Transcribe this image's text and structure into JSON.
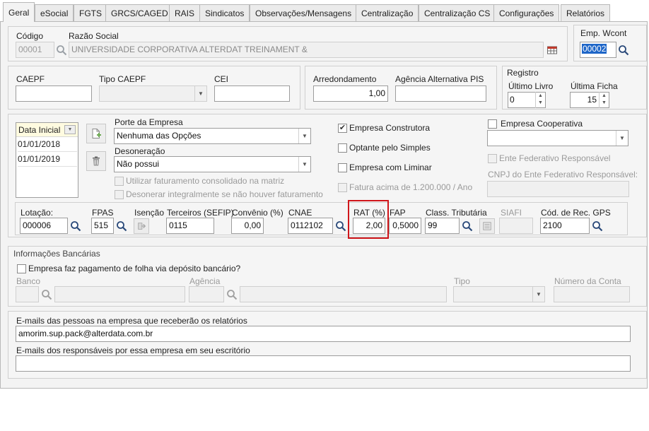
{
  "tabs": [
    "Geral",
    "eSocial",
    "FGTS",
    "GRCS/CAGED",
    "RAIS",
    "Sindicatos",
    "Observações/Mensagens",
    "Centralização",
    "Centralização CS",
    "Configurações",
    "Relatórios"
  ],
  "empresa": {
    "codigo_label": "Código",
    "codigo_value": "00001",
    "razao_label": "Razão Social",
    "razao_value": "UNIVERSIDADE CORPORATIVA ALTERDAT TREINAMENT &",
    "wcont_label": "Emp. Wcont",
    "wcont_value": "00002"
  },
  "caepf": {
    "caepf_label": "CAEPF",
    "tipo_label": "Tipo CAEPF",
    "cei_label": "CEI"
  },
  "arred": {
    "arred_label": "Arredondamento",
    "arred_value": "1,00",
    "agencia_label": "Agência Alternativa PIS"
  },
  "registro": {
    "title": "Registro",
    "livro_label": "Último Livro",
    "livro_value": "0",
    "ficha_label": "Última Ficha",
    "ficha_value": "15"
  },
  "datas": {
    "header": "Data Inicial",
    "rows": [
      "01/01/2018",
      "01/01/2019"
    ]
  },
  "porte": {
    "label": "Porte da Empresa",
    "value": "Nenhuma das Opções"
  },
  "deson": {
    "label": "Desoneração",
    "value": "Não possui"
  },
  "opcoes": {
    "fat_consolidado": "Utilizar faturamento consolidado na matriz",
    "desonerar_integral": "Desonerar integralmente se não houver faturamento",
    "construtora": "Empresa Construtora",
    "simples": "Optante pelo Simples",
    "liminar": "Empresa com Liminar",
    "fatura_acima": "Fatura acima de 1.200.000 / Ano",
    "cooperativa": "Empresa Cooperativa",
    "ente_federativo": "Ente Federativo Responsável",
    "cnpj_ente": "CNPJ do Ente Federativo Responsável:"
  },
  "lotacao": {
    "lotacao_label": "Lotação:",
    "lotacao_value": "000006",
    "fpas_label": "FPAS",
    "fpas_value": "515",
    "isencao_label": "Isenção",
    "terceiros_label": "Terceiros (SEFIP)",
    "terceiros_value": "0115",
    "convenio_label": "Convênio (%)",
    "convenio_value": "0,00",
    "cnae_label": "CNAE",
    "cnae_value": "0112102",
    "rat_label": "RAT (%)",
    "rat_value": "2,00",
    "fap_label": "FAP",
    "fap_value": "0,5000",
    "class_label": "Class. Tributária",
    "class_value": "99",
    "siafi_label": "SIAFI",
    "gps_label": "Cód. de Rec. GPS",
    "gps_value": "2100"
  },
  "banco": {
    "title": "Informações Bancárias",
    "deposito": "Empresa faz pagamento de folha via depósito bancário?",
    "banco_label": "Banco",
    "agencia_label": "Agência",
    "tipo_label": "Tipo",
    "conta_label": "Número da Conta"
  },
  "emails": {
    "pessoas_label": "E-mails das pessoas na empresa que receberão os relatórios",
    "pessoas_value": "amorim.sup.pack@alterdata.com.br",
    "resp_label": "E-mails dos responsáveis por essa empresa em seu escritório"
  },
  "colors": {
    "highlight": "#d0161b",
    "selection": "#1e66c8"
  }
}
